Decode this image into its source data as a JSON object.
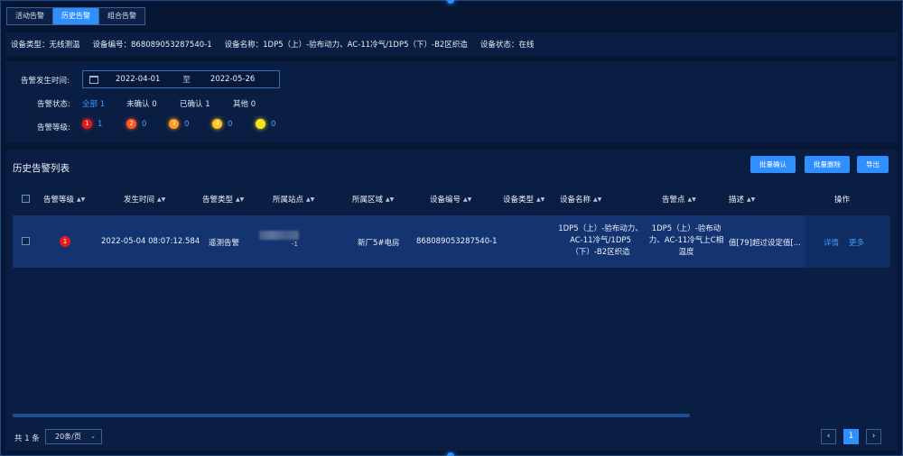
{
  "tabs": [
    {
      "label": "活动告警"
    },
    {
      "label": "历史告警",
      "active": true
    },
    {
      "label": "组合告警"
    }
  ],
  "device_info": {
    "type": "设备类型：无线测温",
    "number": "设备编号：868089053287540-1",
    "name": "设备名称：1DP5（上）-验布动力、AC-11冷气/1DP5（下）-B2区织造",
    "status": "设备状态：在线"
  },
  "filter": {
    "time_label": "告警发生时间:",
    "date_start": "2022-04-01",
    "date_sep": "至",
    "date_end": "2022-05-26",
    "status_label": "告警状态:",
    "status_options": [
      {
        "label": "全部 1",
        "active": true
      },
      {
        "label": "未确认 0"
      },
      {
        "label": "已确认 1"
      },
      {
        "label": "其他 0"
      }
    ],
    "level_label": "告警等级:",
    "levels": [
      {
        "icon": "1",
        "count": "1",
        "color": "#e11b1b"
      },
      {
        "icon": "2",
        "count": "0",
        "color": "#ff5a1f"
      },
      {
        "icon": "3",
        "count": "0",
        "color": "#ff9a1f"
      },
      {
        "icon": "4",
        "count": "0",
        "color": "#ffc21a"
      },
      {
        "icon": "",
        "count": "0",
        "color": "#f6e51c"
      }
    ]
  },
  "list": {
    "title": "历史告警列表",
    "buttons": {
      "confirm": "批量确认",
      "delete": "批量删除",
      "export": "导出"
    },
    "headers": {
      "level": "告警等级",
      "time": "发生时间",
      "type": "告警类型",
      "site": "所属站点",
      "area": "所属区域",
      "device_no": "设备编号",
      "device_type": "设备类型",
      "device_name": "设备名称",
      "point": "告警点",
      "desc": "描述",
      "op": "操作"
    },
    "row": {
      "level": "1",
      "time": "2022-05-04 08:07:12.584",
      "type": "遥测告警",
      "site_tail": "-1",
      "area": "新厂5#电房",
      "device_no": "868089053287540-1",
      "device_name": "1DP5（上）-验布动力、AC-11冷气/1DP5（下）-B2区织造",
      "point": "1DP5（上）-验布动力、AC-11冷气上C相温度",
      "desc": "值[79]超过设定值[...",
      "detail": "详情",
      "more": "更多"
    }
  },
  "pagination": {
    "total": "共 1 条",
    "page_size": "20条/页",
    "prev": "‹",
    "page": "1",
    "next": "›"
  },
  "colors": {
    "accent": "#2f8fff",
    "panel": "#0a1e44",
    "background": "#071633",
    "row": "#133470"
  }
}
